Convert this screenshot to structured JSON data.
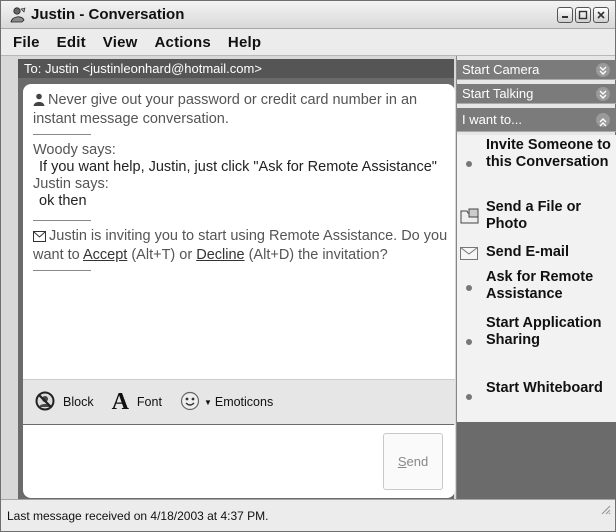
{
  "window": {
    "title": "Justin - Conversation"
  },
  "menu": [
    "File",
    "Edit",
    "View",
    "Actions",
    "Help"
  ],
  "to_bar": "To:  Justin <justinleonhard@hotmail.com>",
  "history": {
    "warning": "Never give out your password or credit card number in an instant message conversation.",
    "msg1_sender": "Woody says:",
    "msg1_text": "If you want help, Justin, just click \"Ask for Remote Assistance\"",
    "msg2_sender": "Justin says:",
    "msg2_text": "ok then",
    "invite_prefix": "Justin is inviting you to start using Remote Assistance. Do you want to ",
    "accept_link": "Accept",
    "accept_shortcut": " (Alt+T) or ",
    "decline_link": "Decline",
    "decline_suffix": " (Alt+D) the invitation?"
  },
  "toolbar": {
    "block": "Block",
    "font": "Font",
    "emoticons": "Emoticons"
  },
  "send_button": {
    "underlined": "S",
    "rest": "end"
  },
  "sidepane": {
    "start_camera": "Start Camera",
    "start_talking": "Start Talking",
    "i_want_to": "I want to...",
    "tasks": [
      "Invite Someone to this Conversation",
      "Send a File or Photo",
      "Send E-mail",
      "Ask for Remote Assistance",
      "Start Application Sharing",
      "Start Whiteboard"
    ]
  },
  "status": "Last message received on 4/18/2003 at 4:37 PM.",
  "icons": {
    "title": "messenger-user-icon",
    "warning": "person-icon",
    "invite": "envelope-icon",
    "block": "block-icon",
    "font": "font-icon",
    "emoticons": "smiley-icon",
    "send_file": "folder-photo-icon",
    "send_email": "envelope-icon"
  }
}
